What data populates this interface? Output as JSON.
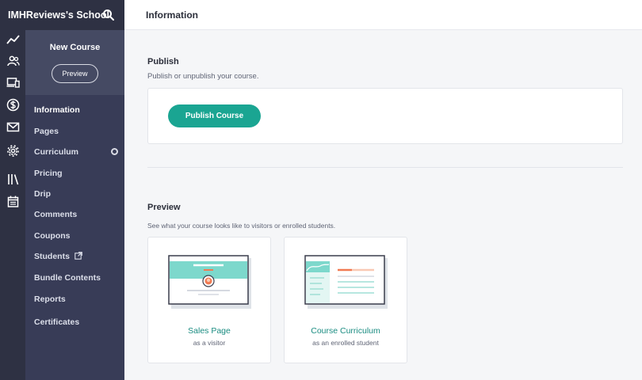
{
  "school": {
    "name": "IMHReviews's School"
  },
  "rail": {
    "icons": [
      "trend-icon",
      "users-icon",
      "devices-icon",
      "dollar-icon",
      "mail-icon",
      "settings-icon",
      "library-icon",
      "calendar-icon"
    ]
  },
  "course_nav": {
    "title": "New Course",
    "preview_label": "Preview",
    "items": [
      {
        "label": "Information",
        "active": true
      },
      {
        "label": "Pages"
      },
      {
        "label": "Curriculum"
      },
      {
        "label": "Pricing"
      },
      {
        "label": "Drip"
      },
      {
        "label": "Comments"
      },
      {
        "label": "Coupons"
      },
      {
        "label": "Students"
      },
      {
        "label": "Bundle Contents"
      },
      {
        "label": "Reports"
      },
      {
        "label": "Certificates"
      }
    ]
  },
  "topbar": {
    "title": "Information"
  },
  "publish": {
    "title": "Publish",
    "description": "Publish or unpublish your course.",
    "button_label": "Publish Course"
  },
  "preview": {
    "title": "Preview",
    "description": "See what your course looks like to visitors or enrolled students.",
    "cards": [
      {
        "title": "Sales Page",
        "subtitle": "as a visitor"
      },
      {
        "title": "Course Curriculum",
        "subtitle": "as an enrolled student"
      }
    ]
  },
  "colors": {
    "accent": "#1aa592",
    "sidebar": "#383c57",
    "rail": "#2e3143",
    "illus_teal": "#7dd8cc",
    "illus_orange": "#f17a52"
  }
}
